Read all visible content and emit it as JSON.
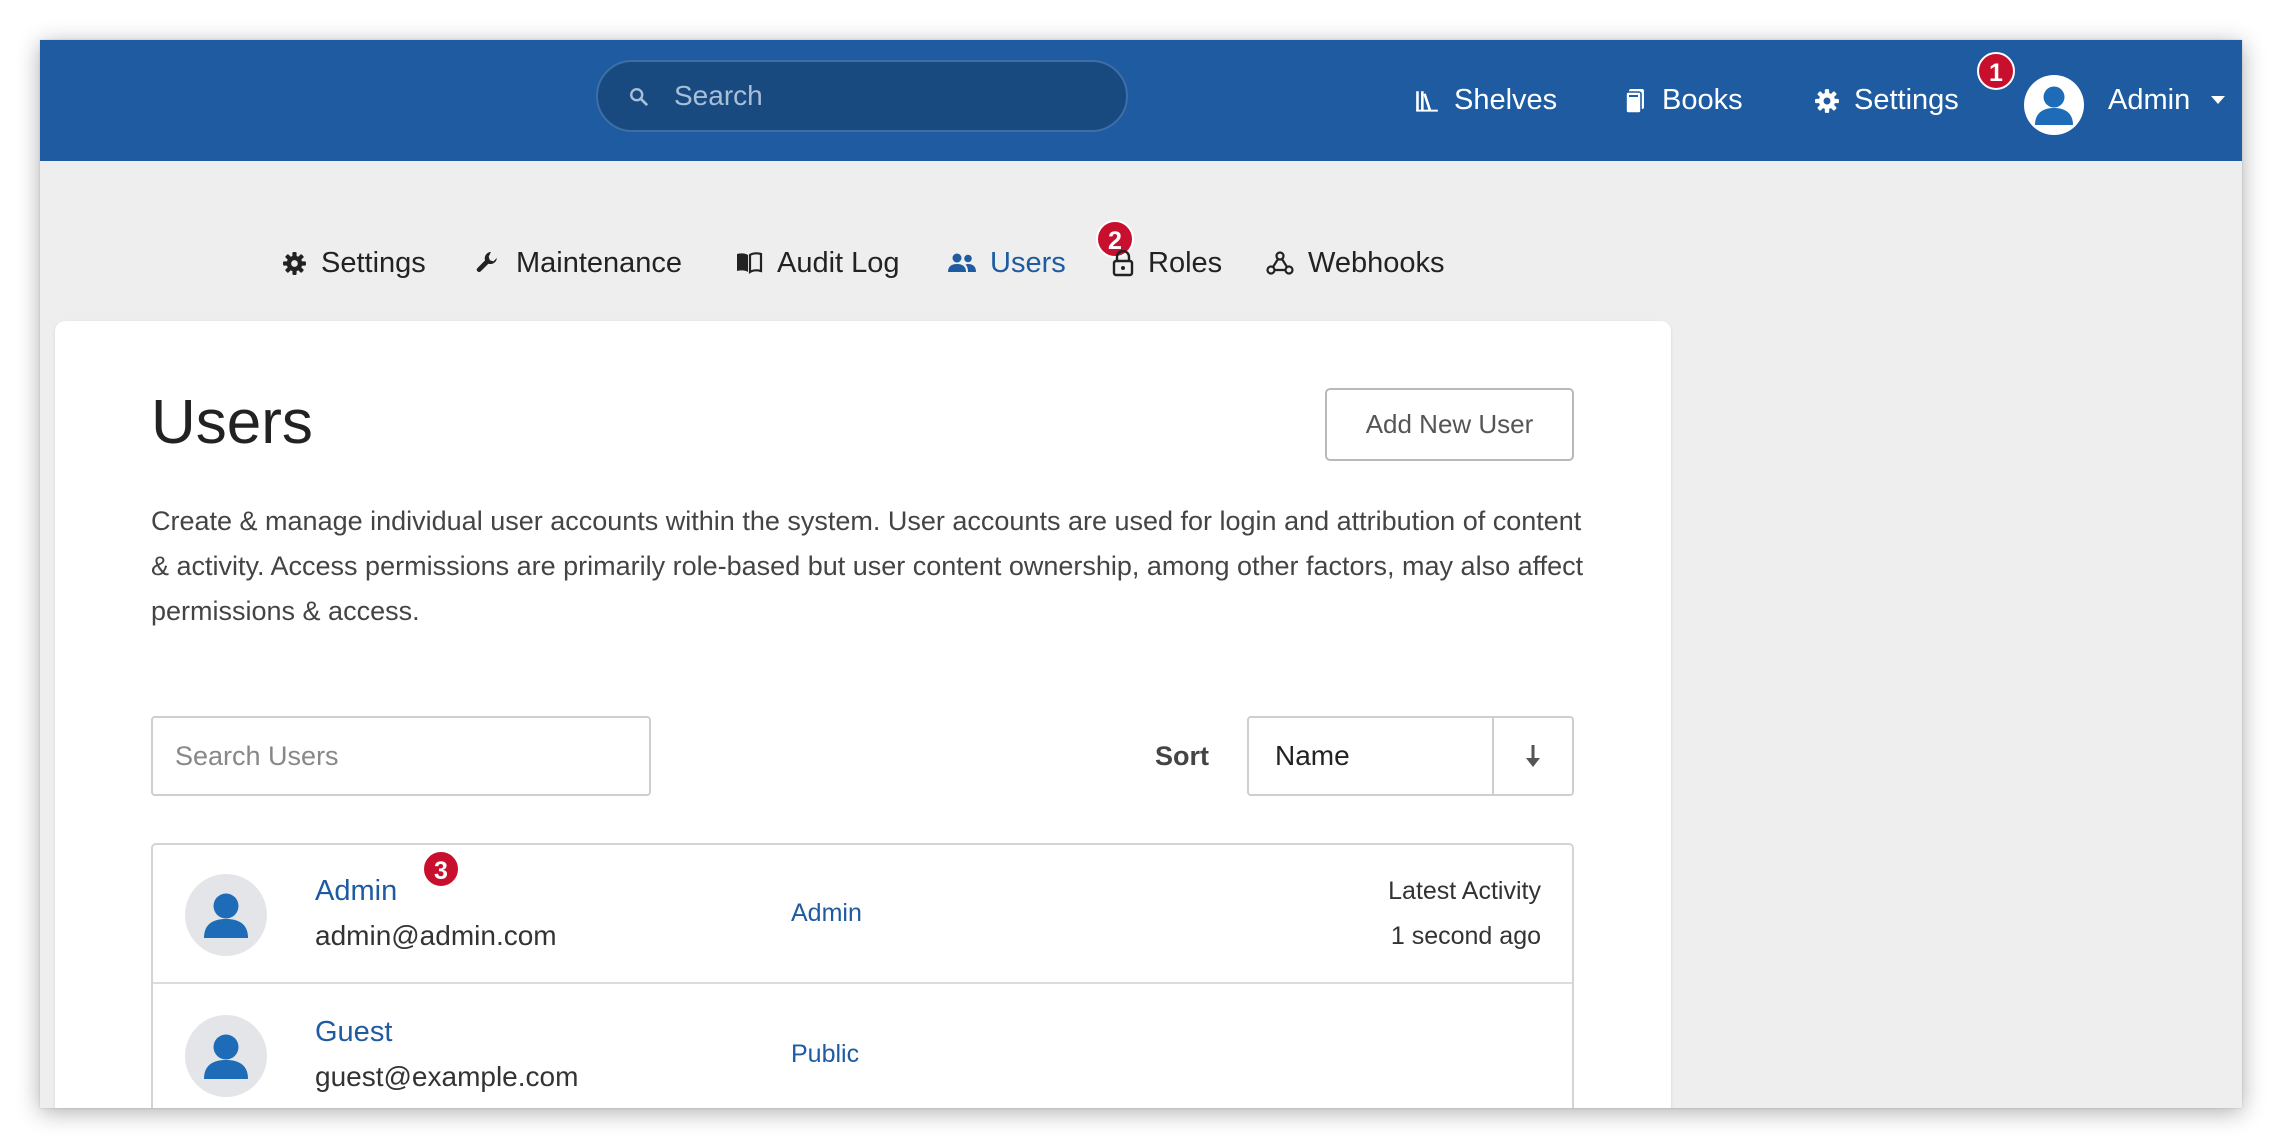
{
  "header": {
    "search_placeholder": "Search",
    "nav": {
      "shelves": "Shelves",
      "books": "Books",
      "settings": "Settings"
    },
    "user_name": "Admin"
  },
  "badges": [
    "1",
    "2",
    "3"
  ],
  "subnav": {
    "settings": "Settings",
    "maintenance": "Maintenance",
    "audit_log": "Audit Log",
    "users": "Users",
    "roles": "Roles",
    "webhooks": "Webhooks"
  },
  "main": {
    "title": "Users",
    "add_button": "Add New User",
    "description": "Create & manage individual user accounts within the system. User accounts are used for login and attribution of content & activity. Access permissions are primarily role-based but user content ownership, among other factors, may also affect permissions & access.",
    "search_placeholder": "Search Users",
    "sort_label": "Sort",
    "sort_value": "Name",
    "sort_direction_icon": "arrow-down-icon"
  },
  "users": [
    {
      "name": "Admin",
      "email": "admin@admin.com",
      "role": "Admin",
      "activity_label": "Latest Activity",
      "activity_value": "1 second ago"
    },
    {
      "name": "Guest",
      "email": "guest@example.com",
      "role": "Public"
    }
  ],
  "colors": {
    "header_bg": "#1e5ba1",
    "accent": "#1e5ba1",
    "badge": "#c8102e",
    "page_bg": "#eeeeee"
  }
}
